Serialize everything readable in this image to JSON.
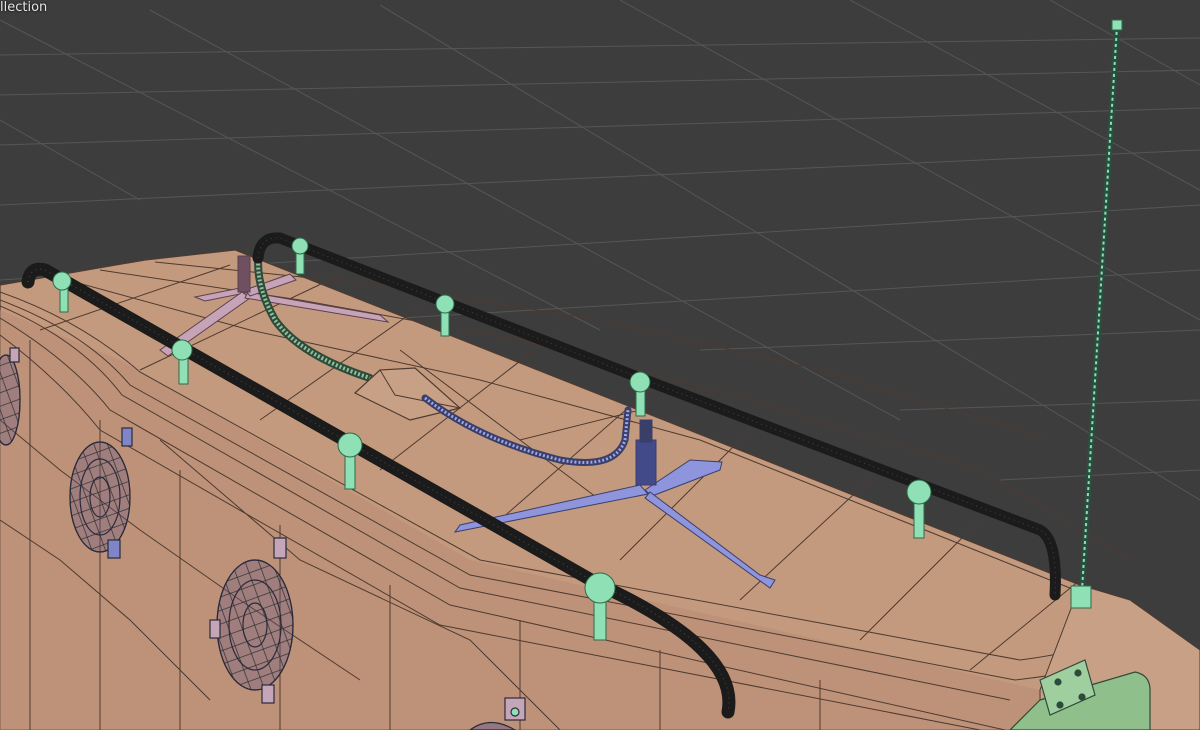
{
  "app": "3D viewport",
  "viewport": {
    "overlay_label": "llection",
    "shading": "wireframe-overlay",
    "colors": {
      "background": "#3d3d3d",
      "grid": "#565656",
      "body": "#c49a7e",
      "wire": "#4e3a30",
      "rail": "#1b1b1b",
      "support": "#8fe0b4",
      "antenna": "#5aa58a",
      "mount_blue": "#8e95dc",
      "mount_pink": "#c7a3b8",
      "fan": "#6a5a8a",
      "panel": "#8fbf8a"
    },
    "objects": [
      "roof-body",
      "roof-rail-front",
      "roof-rail-back",
      "rail-supports",
      "antenna",
      "antenna-mount-blue",
      "antenna-mount-pink",
      "cable-green",
      "cable-blue",
      "cable-cover",
      "fan-grilles",
      "hinge-panel"
    ]
  }
}
